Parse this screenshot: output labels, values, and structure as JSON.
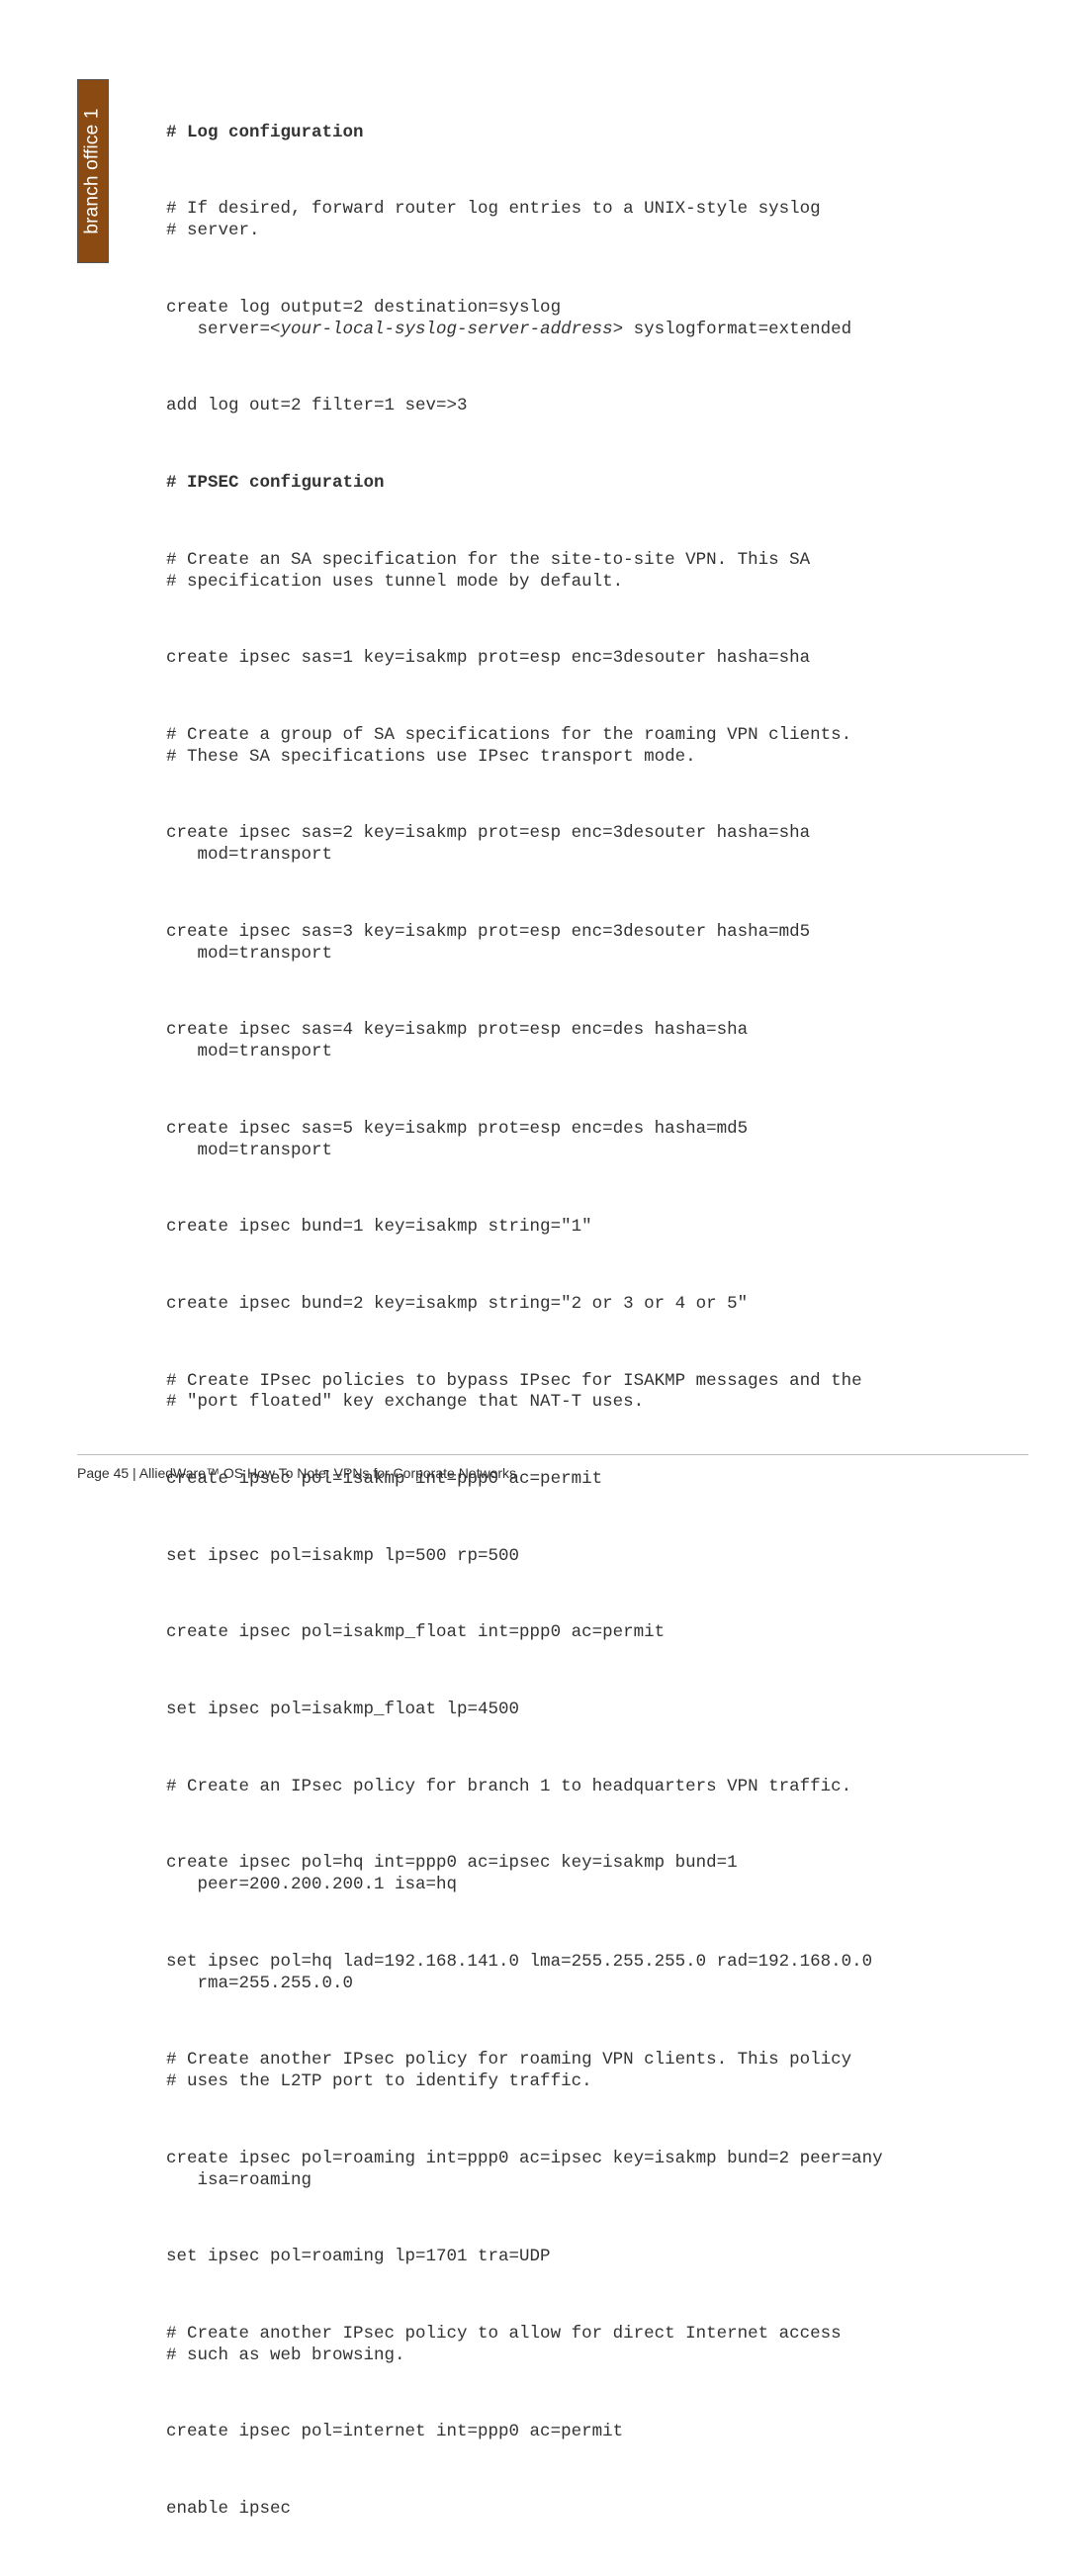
{
  "side_tab": "branch office 1",
  "footer": "Page 45 | AlliedWare™ OS How To Note: VPNs for Corporate Networks",
  "lines": {
    "h1": "# Log configuration",
    "l1a": "# If desired, forward router log entries to a UNIX-style syslog",
    "l1b": "# server.",
    "l2a": "create log output=2 destination=syslog",
    "l2b_pre": "   server=<",
    "l2b_it": "your-local-syslog-server-address",
    "l2b_post": "> syslogformat=extended",
    "l3": "add log out=2 filter=1 sev=>3",
    "h2": "# IPSEC configuration",
    "l4a": "# Create an SA specification for the site-to-site VPN. This SA",
    "l4b": "# specification uses tunnel mode by default.",
    "l5": "create ipsec sas=1 key=isakmp prot=esp enc=3desouter hasha=sha",
    "l6a": "# Create a group of SA specifications for the roaming VPN clients.",
    "l6b": "# These SA specifications use IPsec transport mode.",
    "l7a": "create ipsec sas=2 key=isakmp prot=esp enc=3desouter hasha=sha",
    "l7b": "   mod=transport",
    "l8a": "create ipsec sas=3 key=isakmp prot=esp enc=3desouter hasha=md5",
    "l8b": "   mod=transport",
    "l9a": "create ipsec sas=4 key=isakmp prot=esp enc=des hasha=sha",
    "l9b": "   mod=transport",
    "l10a": "create ipsec sas=5 key=isakmp prot=esp enc=des hasha=md5",
    "l10b": "   mod=transport",
    "l11": "create ipsec bund=1 key=isakmp string=\"1\"",
    "l12": "create ipsec bund=2 key=isakmp string=\"2 or 3 or 4 or 5\"",
    "l13a": "# Create IPsec policies to bypass IPsec for ISAKMP messages and the",
    "l13b": "# \"port floated\" key exchange that NAT-T uses.",
    "l14": "create ipsec pol=isakmp int=ppp0 ac=permit",
    "l15": "set ipsec pol=isakmp lp=500 rp=500",
    "l16": "create ipsec pol=isakmp_float int=ppp0 ac=permit",
    "l17": "set ipsec pol=isakmp_float lp=4500",
    "l18": "# Create an IPsec policy for branch 1 to headquarters VPN traffic.",
    "l19a": "create ipsec pol=hq int=ppp0 ac=ipsec key=isakmp bund=1",
    "l19b": "   peer=200.200.200.1 isa=hq",
    "l20a": "set ipsec pol=hq lad=192.168.141.0 lma=255.255.255.0 rad=192.168.0.0",
    "l20b": "   rma=255.255.0.0",
    "l21a": "# Create another IPsec policy for roaming VPN clients. This policy",
    "l21b": "# uses the L2TP port to identify traffic.",
    "l22a": "create ipsec pol=roaming int=ppp0 ac=ipsec key=isakmp bund=2 peer=any",
    "l22b": "   isa=roaming",
    "l23": "set ipsec pol=roaming lp=1701 tra=UDP",
    "l24a": "# Create another IPsec policy to allow for direct Internet access",
    "l24b": "# such as web browsing.",
    "l25": "create ipsec pol=internet int=ppp0 ac=permit",
    "l26": "enable ipsec"
  }
}
